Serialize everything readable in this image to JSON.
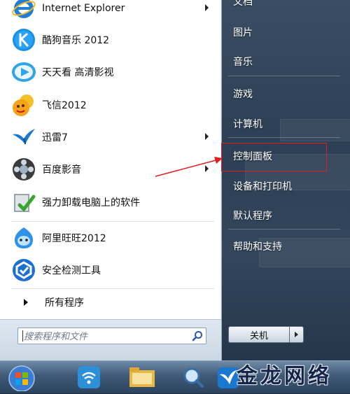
{
  "programs": [
    {
      "label": "Internet Explorer",
      "icon": "internet-explorer-icon",
      "has_submenu": true
    },
    {
      "label": "酷狗音乐 2012",
      "icon": "kugou-music-icon",
      "has_submenu": false
    },
    {
      "label": "天天看 高清影视",
      "icon": "tiantiankan-video-icon",
      "has_submenu": false
    },
    {
      "label": "飞信2012",
      "icon": "fetion-icon",
      "has_submenu": false
    },
    {
      "label": "迅雷7",
      "icon": "xunlei-icon",
      "has_submenu": true
    },
    {
      "label": "百度影音",
      "icon": "baidu-player-icon",
      "has_submenu": true
    },
    {
      "label": "强力卸载电脑上的软件",
      "icon": "uninstaller-icon",
      "has_submenu": false
    },
    {
      "label": "阿里旺旺2012",
      "icon": "aliwangwang-icon",
      "has_submenu": false
    },
    {
      "label": "安全检测工具",
      "icon": "security-check-icon",
      "has_submenu": false
    }
  ],
  "all_programs": "所有程序",
  "search": {
    "placeholder": "搜索程序和文件"
  },
  "right_items": [
    {
      "label": "文档"
    },
    {
      "label": "图片"
    },
    {
      "label": "音乐"
    },
    {
      "label": "游戏"
    },
    {
      "label": "计算机"
    },
    {
      "label": "控制面板"
    },
    {
      "label": "设备和打印机"
    },
    {
      "label": "默认程序"
    },
    {
      "label": "帮助和支持"
    }
  ],
  "shutdown": {
    "label": "关机"
  },
  "watermark": "金龙网络",
  "colors": {
    "highlight": "#e02020",
    "taskbar": "#3f5a78"
  },
  "taskbar_icons": [
    "start-orb-icon",
    "wireless-network-icon",
    "file-explorer-icon",
    "search-magnifier-icon",
    "xunlei-taskbar-icon"
  ]
}
